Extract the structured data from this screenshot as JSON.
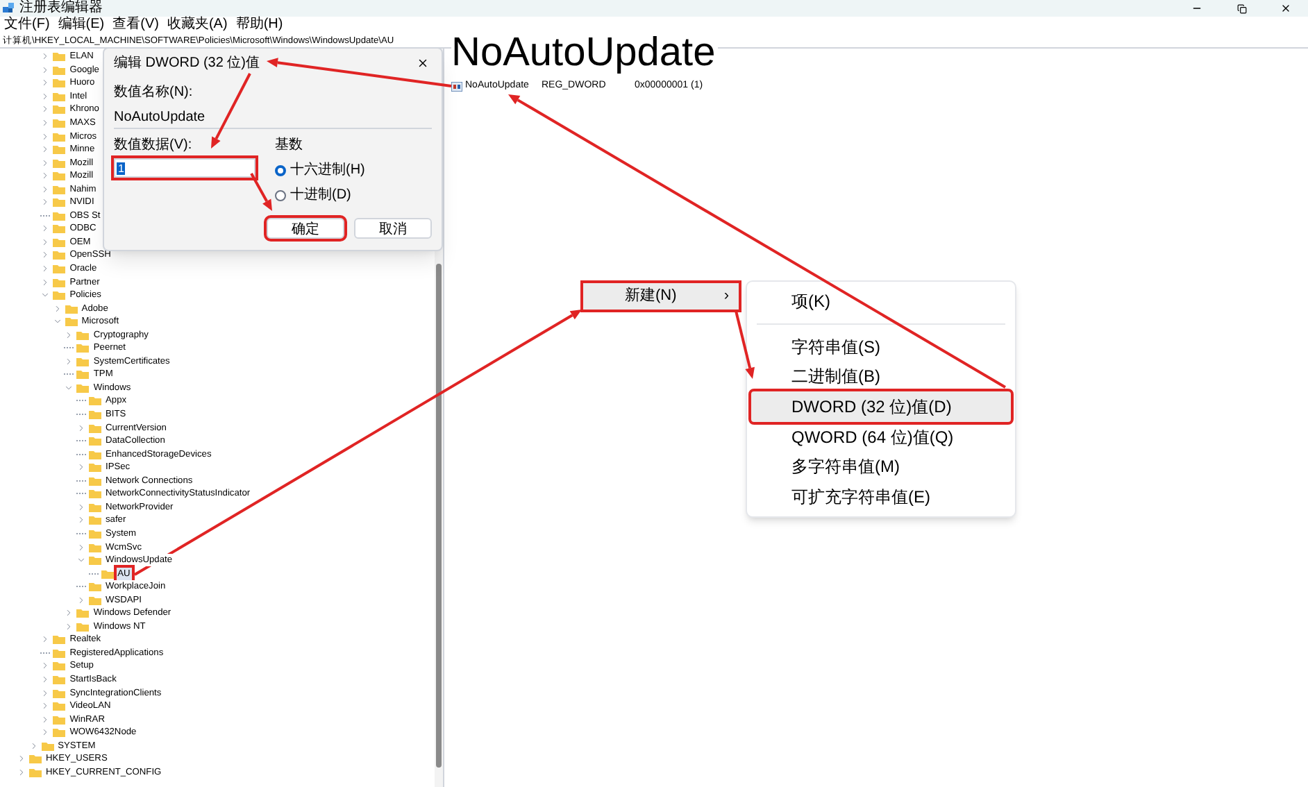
{
  "window": {
    "title": "注册表编辑器"
  },
  "menu": [
    "文件(F)",
    "编辑(E)",
    "查看(V)",
    "收藏夹(A)",
    "帮助(H)"
  ],
  "address": "计算机\\HKEY_LOCAL_MACHINE\\SOFTWARE\\Policies\\Microsoft\\Windows\\WindowsUpdate\\AU",
  "tree": [
    {
      "children": [
        {
          "children": [
            {
              "label": "ELAN",
              "kind": "branch",
              "expanded": false,
              "selected": false,
              "annotated": false
            },
            {
              "label": "Google",
              "kind": "branch",
              "expanded": false,
              "selected": false,
              "annotated": false
            },
            {
              "label": "Huoro",
              "kind": "branch",
              "expanded": false,
              "selected": false,
              "annotated": false
            },
            {
              "label": "Intel",
              "kind": "branch",
              "expanded": false,
              "selected": false,
              "annotated": false
            },
            {
              "label": "Khrono",
              "kind": "branch",
              "expanded": false,
              "selected": false,
              "annotated": false
            },
            {
              "label": "MAXS",
              "kind": "branch",
              "expanded": false,
              "selected": false,
              "annotated": false
            },
            {
              "label": "Micros",
              "kind": "branch",
              "expanded": false,
              "selected": false,
              "annotated": false
            },
            {
              "label": "Minne",
              "kind": "branch",
              "expanded": false,
              "selected": false,
              "annotated": false
            },
            {
              "label": "Mozill",
              "kind": "branch",
              "expanded": false,
              "selected": false,
              "annotated": false
            },
            {
              "label": "Mozill",
              "kind": "branch",
              "expanded": false,
              "selected": false,
              "annotated": false
            },
            {
              "label": "Nahim",
              "kind": "branch",
              "expanded": false,
              "selected": false,
              "annotated": false
            },
            {
              "label": "NVIDI",
              "kind": "branch",
              "expanded": false,
              "selected": false,
              "annotated": false
            },
            {
              "label": "OBS St",
              "kind": "leaf",
              "selected": false,
              "annotated": false
            },
            {
              "label": "ODBC",
              "kind": "branch",
              "expanded": false,
              "selected": false,
              "annotated": false
            },
            {
              "label": "OEM",
              "kind": "branch",
              "expanded": false,
              "selected": false,
              "annotated": false
            },
            {
              "label": "OpenSSH",
              "kind": "branch",
              "expanded": false,
              "selected": false,
              "annotated": false
            },
            {
              "label": "Oracle",
              "kind": "branch",
              "expanded": false,
              "selected": false,
              "annotated": false
            },
            {
              "label": "Partner",
              "kind": "branch",
              "expanded": false,
              "selected": false,
              "annotated": false
            },
            {
              "label": "Policies",
              "kind": "branch",
              "expanded": true,
              "selected": false,
              "annotated": false,
              "children": [
                {
                  "label": "Adobe",
                  "kind": "branch",
                  "expanded": false,
                  "selected": false,
                  "annotated": false
                },
                {
                  "label": "Microsoft",
                  "kind": "branch",
                  "expanded": true,
                  "selected": false,
                  "annotated": false,
                  "children": [
                    {
                      "label": "Cryptography",
                      "kind": "branch",
                      "expanded": false,
                      "selected": false,
                      "annotated": false
                    },
                    {
                      "label": "Peernet",
                      "kind": "leaf",
                      "selected": false,
                      "annotated": false
                    },
                    {
                      "label": "SystemCertificates",
                      "kind": "branch",
                      "expanded": false,
                      "selected": false,
                      "annotated": false
                    },
                    {
                      "label": "TPM",
                      "kind": "leaf",
                      "selected": false,
                      "annotated": false
                    },
                    {
                      "label": "Windows",
                      "kind": "branch",
                      "expanded": true,
                      "selected": false,
                      "annotated": false,
                      "children": [
                        {
                          "label": "Appx",
                          "kind": "leaf",
                          "selected": false,
                          "annotated": false
                        },
                        {
                          "label": "BITS",
                          "kind": "leaf",
                          "selected": false,
                          "annotated": false
                        },
                        {
                          "label": "CurrentVersion",
                          "kind": "branch",
                          "expanded": false,
                          "selected": false,
                          "annotated": false
                        },
                        {
                          "label": "DataCollection",
                          "kind": "leaf",
                          "selected": false,
                          "annotated": false
                        },
                        {
                          "label": "EnhancedStorageDevices",
                          "kind": "leaf",
                          "selected": false,
                          "annotated": false
                        },
                        {
                          "label": "IPSec",
                          "kind": "branch",
                          "expanded": false,
                          "selected": false,
                          "annotated": false
                        },
                        {
                          "label": "Network Connections",
                          "kind": "leaf",
                          "selected": false,
                          "annotated": false
                        },
                        {
                          "label": "NetworkConnectivityStatusIndicator",
                          "kind": "leaf",
                          "selected": false,
                          "annotated": false
                        },
                        {
                          "label": "NetworkProvider",
                          "kind": "branch",
                          "expanded": false,
                          "selected": false,
                          "annotated": false
                        },
                        {
                          "label": "safer",
                          "kind": "branch",
                          "expanded": false,
                          "selected": false,
                          "annotated": false
                        },
                        {
                          "label": "System",
                          "kind": "leaf",
                          "selected": false,
                          "annotated": false
                        },
                        {
                          "label": "WcmSvc",
                          "kind": "branch",
                          "expanded": false,
                          "selected": false,
                          "annotated": false
                        },
                        {
                          "label": "WindowsUpdate",
                          "kind": "branch",
                          "expanded": true,
                          "selected": false,
                          "annotated": false,
                          "children": [
                            {
                              "label": "AU",
                              "kind": "leaf",
                              "selected": true,
                              "annotated": true
                            }
                          ]
                        },
                        {
                          "label": "WorkplaceJoin",
                          "kind": "leaf",
                          "selected": false,
                          "annotated": false
                        },
                        {
                          "label": "WSDAPI",
                          "kind": "branch",
                          "expanded": false,
                          "selected": false,
                          "annotated": false
                        }
                      ]
                    },
                    {
                      "label": "Windows Defender",
                      "kind": "branch",
                      "expanded": false,
                      "selected": false,
                      "annotated": false
                    },
                    {
                      "label": "Windows NT",
                      "kind": "branch",
                      "expanded": false,
                      "selected": false,
                      "annotated": false
                    }
                  ]
                }
              ]
            },
            {
              "label": "Realtek",
              "kind": "branch",
              "expanded": false,
              "selected": false,
              "annotated": false
            },
            {
              "label": "RegisteredApplications",
              "kind": "leaf",
              "selected": false,
              "annotated": false
            },
            {
              "label": "Setup",
              "kind": "branch",
              "expanded": false,
              "selected": false,
              "annotated": false
            },
            {
              "label": "StartIsBack",
              "kind": "branch",
              "expanded": false,
              "selected": false,
              "annotated": false
            },
            {
              "label": "SyncIntegrationClients",
              "kind": "branch",
              "expanded": false,
              "selected": false,
              "annotated": false
            },
            {
              "label": "VideoLAN",
              "kind": "branch",
              "expanded": false,
              "selected": false,
              "annotated": false
            },
            {
              "label": "WinRAR",
              "kind": "branch",
              "expanded": false,
              "selected": false,
              "annotated": false
            },
            {
              "label": "WOW6432Node",
              "kind": "branch",
              "expanded": false,
              "selected": false,
              "annotated": false
            }
          ]
        },
        {
          "label": "SYSTEM",
          "kind": "branch",
          "expanded": false,
          "selected": false,
          "annotated": false
        }
      ]
    },
    {
      "label": "HKEY_USERS",
      "kind": "branch",
      "expanded": false,
      "selected": false,
      "annotated": false
    },
    {
      "label": "HKEY_CURRENT_CONFIG",
      "kind": "branch",
      "expanded": false,
      "selected": false,
      "annotated": false
    }
  ],
  "values": [
    {
      "name": "NoAutoUpdate",
      "type": "REG_DWORD",
      "data": "0x00000001 (1)"
    }
  ],
  "caption": "NoAutoUpdate",
  "dialog": {
    "title": "编辑 DWORD (32 位)值",
    "name_label": "数值名称(N):",
    "name_value": "NoAutoUpdate",
    "data_label": "数值数据(V):",
    "data_value": "1",
    "data_annotated": true,
    "base_label": "基数",
    "base_options": [
      {
        "label": "十六进制(H)",
        "selected": true
      },
      {
        "label": "十进制(D)",
        "selected": false
      }
    ],
    "buttons": [
      {
        "label": "确定",
        "annotated": true
      },
      {
        "label": "取消",
        "annotated": false
      }
    ]
  },
  "context_menu": [
    {
      "label": "新建(N)",
      "chevron": "›",
      "highlighted": true,
      "annotated": true
    }
  ],
  "submenu": [
    {
      "kind": "item",
      "label": "项(K)",
      "highlighted": false,
      "annotated": false
    },
    {
      "kind": "separator"
    },
    {
      "kind": "item",
      "label": "字符串值(S)",
      "highlighted": false,
      "annotated": false
    },
    {
      "kind": "item",
      "label": "二进制值(B)",
      "highlighted": false,
      "annotated": false
    },
    {
      "kind": "item",
      "label": "DWORD (32 位)值(D)",
      "highlighted": true,
      "annotated": true
    },
    {
      "kind": "item",
      "label": "QWORD (64 位)值(Q)",
      "highlighted": false,
      "annotated": false
    },
    {
      "kind": "item",
      "label": "多字符串值(M)",
      "highlighted": false,
      "annotated": false
    },
    {
      "kind": "item",
      "label": "可扩充字符串值(E)",
      "highlighted": false,
      "annotated": false
    }
  ]
}
